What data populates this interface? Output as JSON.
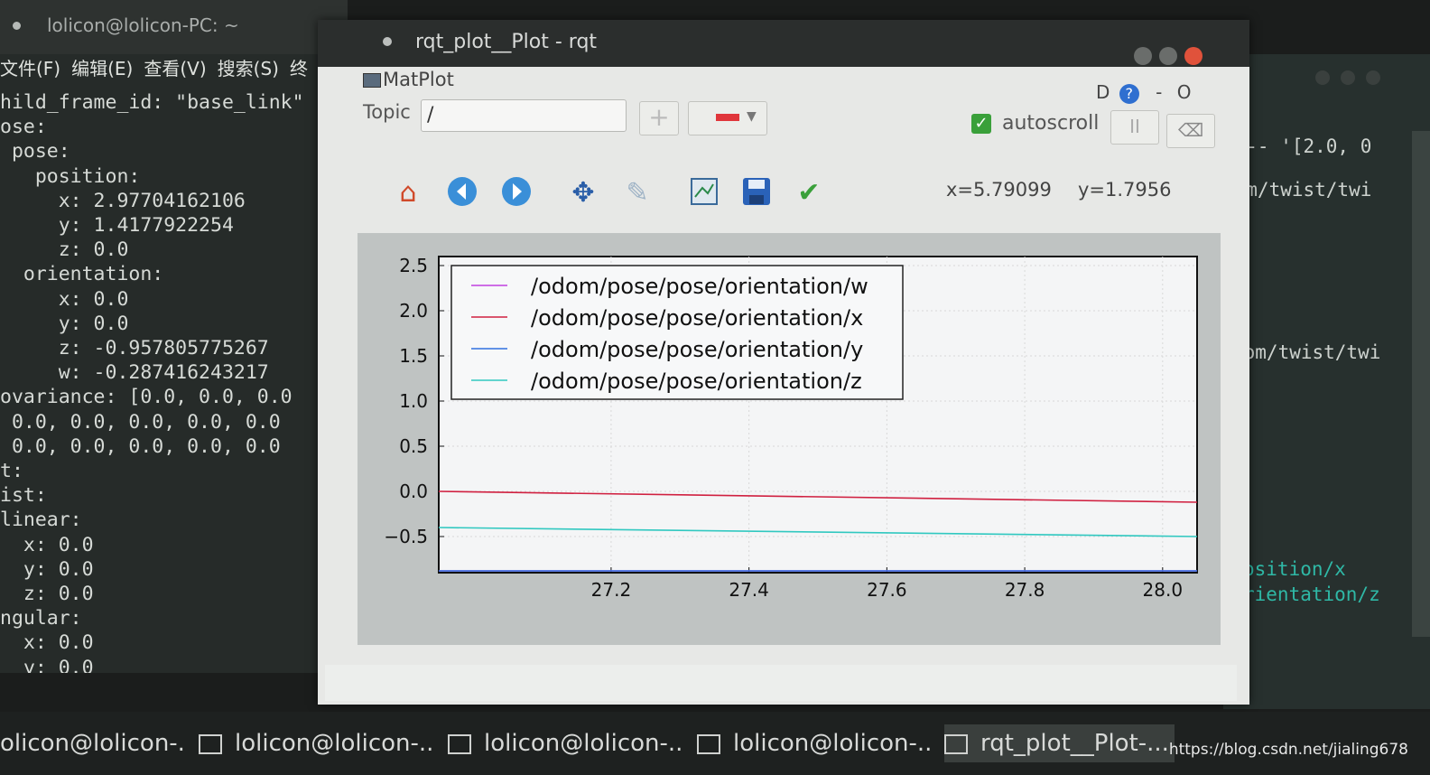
{
  "term_left": {
    "title": "lolicon@lolicon-PC: ~",
    "menu": [
      "文件(F)",
      "编辑(E)",
      "查看(V)",
      "搜索(S)",
      "终"
    ],
    "lines": [
      "hild_frame_id: \"base_link\"",
      "ose:",
      " pose:",
      "   position:",
      "     x: 2.97704162106",
      "     y: 1.4177922254",
      "     z: 0.0",
      "  orientation:",
      "     x: 0.0",
      "     y: 0.0",
      "     z: -0.957805775267",
      "     w: -0.287416243217",
      "ovariance: [0.0, 0.0, 0.0",
      " 0.0, 0.0, 0.0, 0.0, 0.0",
      " 0.0, 0.0, 0.0, 0.0, 0.0",
      "t:",
      "ist:",
      "linear:",
      "  x: 0.0",
      "  y: 0.0",
      "  z: 0.0",
      "ngular:",
      "  x: 0.0",
      "  y: 0.0"
    ]
  },
  "term_right": {
    "lines": [
      "1 -- '[2.0, 0",
      "dom/twist/twi",
      "dom/twist/twi"
    ],
    "teal_lines": [
      "osition/x",
      "rientation/z"
    ]
  },
  "window": {
    "title": "rqt_plot__Plot - rqt"
  },
  "plugin": {
    "title": "MatPlot",
    "dock_label": "D",
    "help_label": "?",
    "minimize_label": "-",
    "close_label": "O"
  },
  "topic": {
    "label": "Topic",
    "value": "/"
  },
  "controls": {
    "add_label": "+",
    "autoscroll_label": "autoscroll",
    "autoscroll_checked": true,
    "pause_label": "II",
    "clear_label": "⌫"
  },
  "toolbar": {
    "icons": [
      "home-icon",
      "back-icon",
      "forward-icon",
      "pan-icon",
      "zoom-icon",
      "subplots-icon",
      "save-icon",
      "edit-curves-icon"
    ],
    "coord_x": "x=5.79099",
    "coord_y": "y=1.7956"
  },
  "chart_data": {
    "type": "line",
    "xlim": [
      26.95,
      28.05
    ],
    "ylim": [
      -0.9,
      2.6
    ],
    "xticks": [
      "27.2",
      "27.4",
      "27.6",
      "27.8",
      "28.0"
    ],
    "xtick_values": [
      27.2,
      27.4,
      27.6,
      27.8,
      28.0
    ],
    "yticks": [
      "2.5",
      "2.0",
      "1.5",
      "1.0",
      "0.5",
      "0.0",
      "−0.5"
    ],
    "ytick_values": [
      2.5,
      2.0,
      1.5,
      1.0,
      0.5,
      0.0,
      -0.5
    ],
    "grid": true,
    "legend_position": "top-left",
    "series": [
      {
        "name": "/odom/pose/pose/orientation/w",
        "color": "#c040e0",
        "x": [
          26.95,
          28.05
        ],
        "y": [
          -0.88,
          -0.88
        ]
      },
      {
        "name": "/odom/pose/pose/orientation/x",
        "color": "#d02040",
        "x": [
          26.95,
          28.05
        ],
        "y": [
          0.0,
          -0.12
        ]
      },
      {
        "name": "/odom/pose/pose/orientation/y",
        "color": "#3070e0",
        "x": [
          26.95,
          28.05
        ],
        "y": [
          -0.88,
          -0.88
        ]
      },
      {
        "name": "/odom/pose/pose/orientation/z",
        "color": "#30c8c0",
        "x": [
          26.95,
          28.05
        ],
        "y": [
          -0.4,
          -0.5
        ]
      }
    ]
  },
  "taskbar": {
    "items": [
      "olicon@lolicon-...",
      "lolicon@lolicon-...",
      "lolicon@lolicon-...",
      "lolicon@lolicon-...",
      "rqt_plot__Plot-..."
    ],
    "watermark": "https://blog.csdn.net/jialing678"
  }
}
